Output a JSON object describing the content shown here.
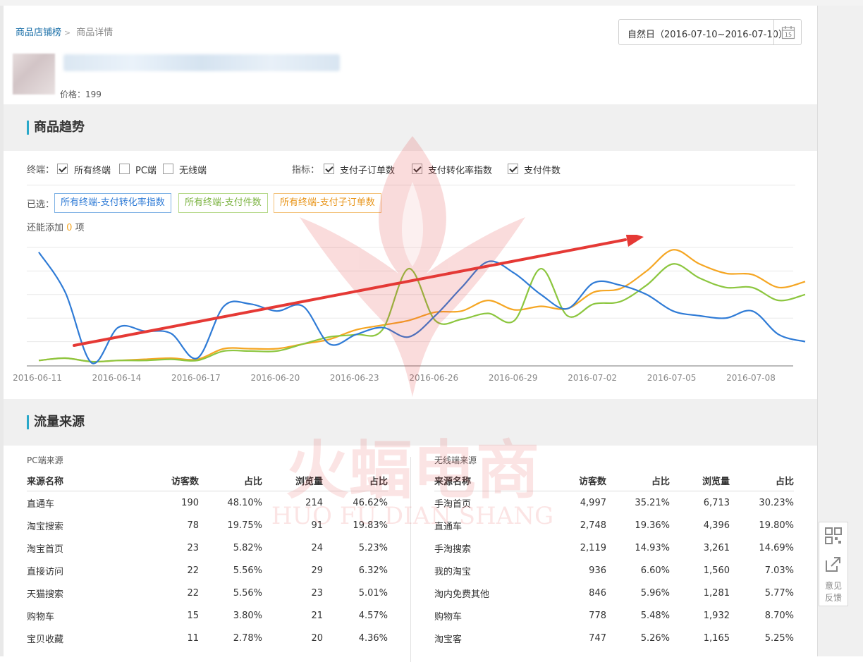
{
  "breadcrumb": {
    "root": "商品店铺榜",
    "current": "商品详情"
  },
  "date_range": {
    "label": "自然日（2016-07-10~2016-07-10）",
    "icon": "calendar-icon",
    "calendar_day": "15"
  },
  "product": {
    "price_label": "价格：199"
  },
  "trend": {
    "title": "商品趋势",
    "terminal_label": "终端：",
    "terminals": [
      {
        "label": "所有终端",
        "checked": true
      },
      {
        "label": "PC端",
        "checked": false
      },
      {
        "label": "无线端",
        "checked": false
      }
    ],
    "metric_label": "指标：",
    "metrics": [
      {
        "label": "支付子订单数",
        "checked": true
      },
      {
        "label": "支付转化率指数",
        "checked": true
      },
      {
        "label": "支付件数",
        "checked": true
      }
    ],
    "selected_label": "已选：",
    "selected": [
      {
        "label": "所有终端-支付转化率指数",
        "color": "#3d8fd8"
      },
      {
        "label": "所有终端-支付件数",
        "color": "#8cc63f"
      },
      {
        "label": "所有终端-支付子订单数",
        "color": "#f5a623"
      }
    ],
    "remaining_prefix": "还能添加",
    "remaining_count": "0",
    "remaining_suffix": "项"
  },
  "chart_data": {
    "type": "line",
    "x": [
      "2016-06-11",
      "2016-06-12",
      "2016-06-13",
      "2016-06-14",
      "2016-06-15",
      "2016-06-16",
      "2016-06-17",
      "2016-06-18",
      "2016-06-19",
      "2016-06-20",
      "2016-06-21",
      "2016-06-22",
      "2016-06-23",
      "2016-06-24",
      "2016-06-25",
      "2016-06-26",
      "2016-06-27",
      "2016-06-28",
      "2016-06-29",
      "2016-06-30",
      "2016-07-01",
      "2016-07-02",
      "2016-07-03",
      "2016-07-04",
      "2016-07-05",
      "2016-07-06",
      "2016-07-07",
      "2016-07-08",
      "2016-07-09",
      "2016-07-10"
    ],
    "xticks": [
      "2016-06-11",
      "2016-06-14",
      "2016-06-17",
      "2016-06-20",
      "2016-06-23",
      "2016-06-26",
      "2016-06-29",
      "2016-07-02",
      "2016-07-05",
      "2016-07-08"
    ],
    "ylim": [
      0,
      5
    ],
    "grid": true,
    "series": [
      {
        "color": "#2f7bd6",
        "values": [
          4.8,
          3.1,
          0.1,
          1.6,
          1.45,
          1.35,
          0.3,
          2.5,
          2.6,
          2.3,
          2.5,
          0.9,
          1.3,
          1.6,
          1.2,
          2.1,
          3.3,
          4.4,
          3.9,
          3.0,
          2.4,
          3.5,
          3.4,
          3.0,
          2.3,
          2.1,
          2.0,
          2.3,
          1.3,
          1.0
        ]
      },
      {
        "color": "#8cc63f",
        "values": [
          0.2,
          0.3,
          0.15,
          0.2,
          0.2,
          0.25,
          0.2,
          0.6,
          0.6,
          0.6,
          0.9,
          1.2,
          1.3,
          1.5,
          4.1,
          1.9,
          1.95,
          2.2,
          1.9,
          4.1,
          2.1,
          2.6,
          2.7,
          3.4,
          4.3,
          3.7,
          3.3,
          3.3,
          2.75,
          3.0
        ]
      },
      {
        "color": "#f5a623",
        "values": [
          0.2,
          0.3,
          0.15,
          0.2,
          0.25,
          0.3,
          0.25,
          0.7,
          0.7,
          0.7,
          0.9,
          1.1,
          1.5,
          1.7,
          1.9,
          2.25,
          2.3,
          2.75,
          2.35,
          2.5,
          2.4,
          3.1,
          3.25,
          4.0,
          4.9,
          4.3,
          3.9,
          3.85,
          3.3,
          3.55
        ]
      }
    ]
  },
  "traffic": {
    "title": "流量来源",
    "pc": {
      "label": "PC端来源",
      "columns": [
        "来源名称",
        "访客数",
        "占比",
        "浏览量",
        "占比"
      ],
      "rows": [
        [
          "直通车",
          "190",
          "48.10%",
          "214",
          "46.62%"
        ],
        [
          "淘宝搜索",
          "78",
          "19.75%",
          "91",
          "19.83%"
        ],
        [
          "淘宝首页",
          "23",
          "5.82%",
          "24",
          "5.23%"
        ],
        [
          "直接访问",
          "22",
          "5.56%",
          "29",
          "6.32%"
        ],
        [
          "天猫搜索",
          "22",
          "5.56%",
          "23",
          "5.01%"
        ],
        [
          "购物车",
          "15",
          "3.80%",
          "21",
          "4.57%"
        ],
        [
          "宝贝收藏",
          "11",
          "2.78%",
          "20",
          "4.36%"
        ]
      ]
    },
    "mobile": {
      "label": "无线端来源",
      "columns": [
        "来源名称",
        "访客数",
        "占比",
        "浏览量",
        "占比"
      ],
      "rows": [
        [
          "手淘首页",
          "4,997",
          "35.21%",
          "6,713",
          "30.23%"
        ],
        [
          "直通车",
          "2,748",
          "19.36%",
          "4,396",
          "19.80%"
        ],
        [
          "手淘搜索",
          "2,119",
          "14.93%",
          "3,261",
          "14.69%"
        ],
        [
          "我的淘宝",
          "936",
          "6.60%",
          "1,560",
          "7.03%"
        ],
        [
          "淘内免费其他",
          "846",
          "5.96%",
          "1,281",
          "5.77%"
        ],
        [
          "购物车",
          "778",
          "5.48%",
          "1,932",
          "8.70%"
        ],
        [
          "淘宝客",
          "747",
          "5.26%",
          "1,165",
          "5.25%"
        ]
      ]
    }
  },
  "side_tools": {
    "qr_icon": "qrcode-icon",
    "feedback_icon": "share-icon",
    "feedback_label": "意见反馈"
  },
  "watermark": {
    "brand": "火蝠电商",
    "pinyin": "HUO FU DIAN SHANG"
  }
}
